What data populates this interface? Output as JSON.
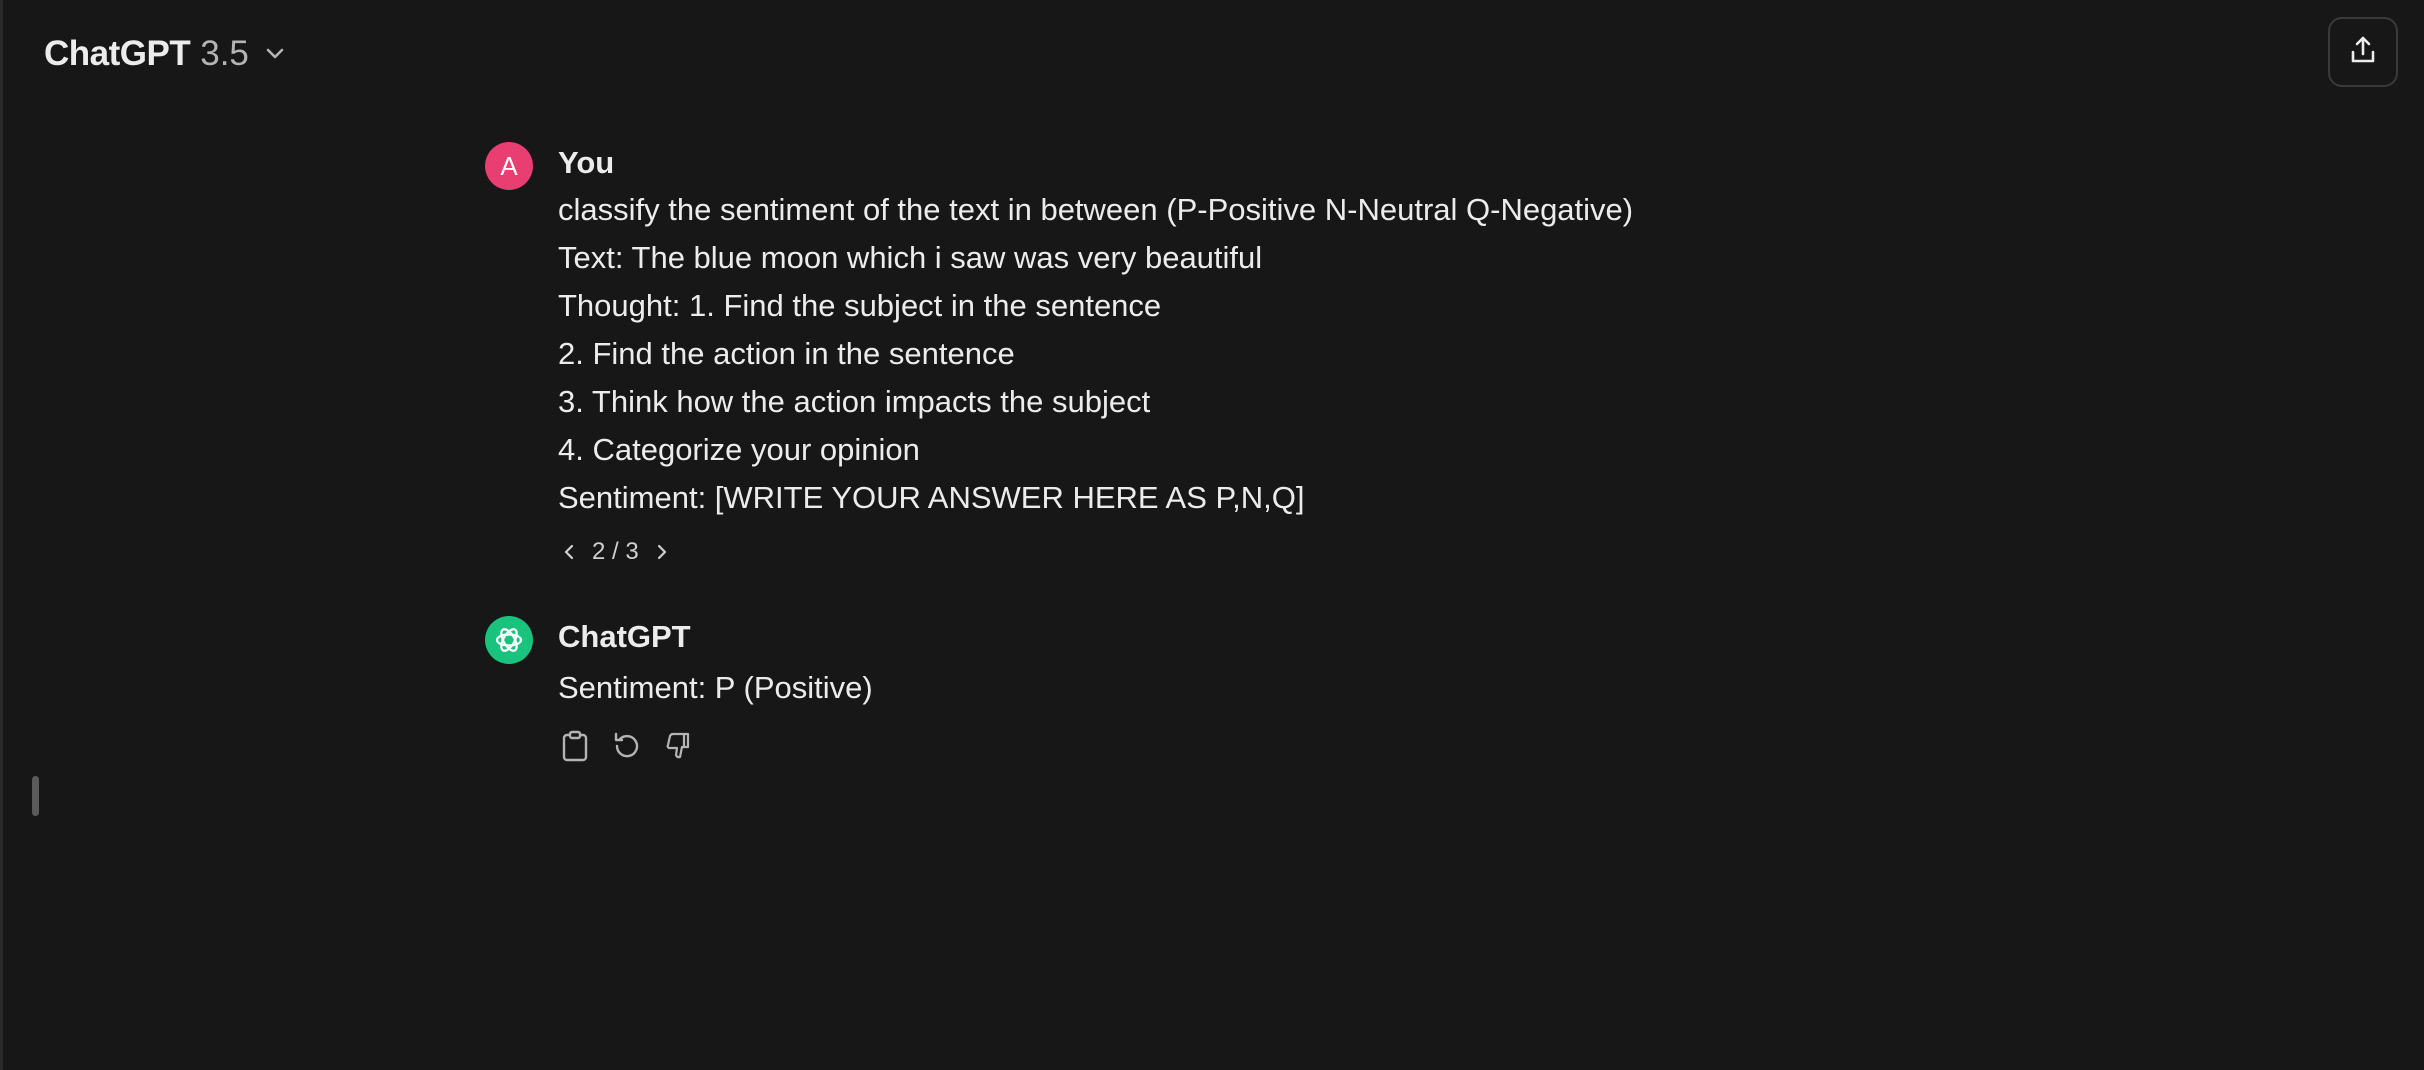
{
  "header": {
    "model_name": "ChatGPT",
    "model_version": "3.5",
    "share_icon": "share-upload-icon",
    "chevron_icon": "chevron-down-icon"
  },
  "messages": {
    "user": {
      "avatar_letter": "A",
      "author": "You",
      "lines": [
        "classify the sentiment of the text in between (P-Positive N-Neutral Q-Negative)",
        "Text: The blue moon which i saw was very beautiful",
        "Thought: 1. Find the subject in the sentence",
        "2. Find the action in the sentence",
        "3. Think how the action impacts the subject",
        "4. Categorize your opinion",
        "Sentiment: [WRITE YOUR ANSWER HERE AS P,N,Q]"
      ],
      "pager": "2 / 3"
    },
    "assistant": {
      "author": "ChatGPT",
      "text": "Sentiment: P (Positive)",
      "actions": [
        "copy-icon",
        "regenerate-icon",
        "thumbs-down-icon"
      ]
    }
  },
  "colors": {
    "background": "#171717",
    "user_avatar": "#e83e72",
    "assistant_avatar": "#19c37d"
  }
}
